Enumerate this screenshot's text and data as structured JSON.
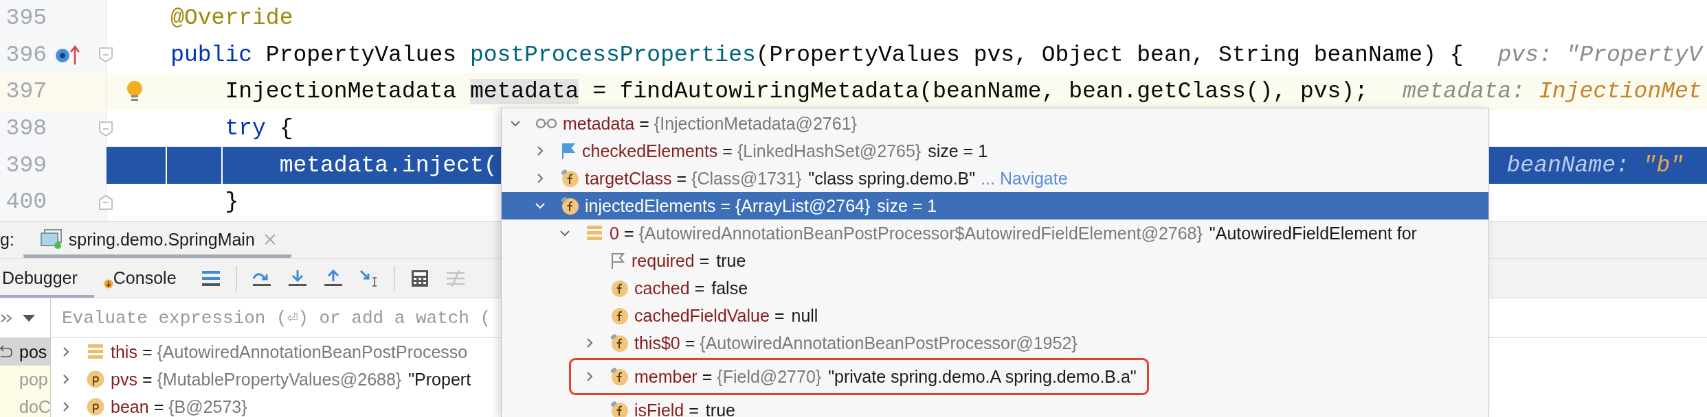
{
  "editor": {
    "lines": [
      {
        "number": "395",
        "caret_line": false,
        "execution_point": false,
        "implements_marker": false,
        "bulb": false,
        "fold_start": false,
        "fold_end": false,
        "segments": [
          {
            "text": "    @Override",
            "kind": "annotation"
          }
        ]
      },
      {
        "number": "396",
        "caret_line": false,
        "execution_point": false,
        "implements_marker": true,
        "bulb": false,
        "fold_start": true,
        "fold_end": false,
        "segments": [
          {
            "text": "    public",
            "kind": "keyword"
          },
          {
            "text": " PropertyValues ",
            "kind": "plain"
          },
          {
            "text": "postProcessProperties",
            "kind": "method"
          },
          {
            "text": "(PropertyValues pvs, Object bean, String beanName) {",
            "kind": "plain"
          }
        ],
        "hint": [
          {
            "text": "pvs: \"PropertyV",
            "kind": "muted"
          }
        ]
      },
      {
        "number": "397",
        "caret_line": true,
        "execution_point": false,
        "implements_marker": false,
        "bulb": true,
        "fold_start": false,
        "fold_end": false,
        "segments": [
          {
            "text": "        InjectionMetadata ",
            "kind": "plain"
          },
          {
            "text": "metadata",
            "kind": "marked"
          },
          {
            "text": " = findAutowiringMetadata(beanName, bean.getClass(), pvs);",
            "kind": "plain"
          }
        ],
        "hint": [
          {
            "text": "metadata: ",
            "kind": "muted"
          },
          {
            "text": "InjectionMet",
            "kind": "accent"
          }
        ]
      },
      {
        "number": "398",
        "caret_line": false,
        "execution_point": false,
        "implements_marker": false,
        "bulb": false,
        "fold_start": true,
        "fold_end": false,
        "segments": [
          {
            "text": "        try",
            "kind": "keyword"
          },
          {
            "text": " {",
            "kind": "plain"
          }
        ]
      },
      {
        "number": "399",
        "caret_line": false,
        "execution_point": true,
        "implements_marker": false,
        "bulb": false,
        "fold_start": false,
        "fold_end": false,
        "segments": [
          {
            "text": "            metadata.inject(",
            "kind": "plain"
          }
        ],
        "hint": [
          {
            "text": "beanName: ",
            "kind": "muted"
          },
          {
            "text": "\"b\"",
            "kind": "accent"
          }
        ]
      },
      {
        "number": "400",
        "caret_line": false,
        "execution_point": false,
        "implements_marker": false,
        "bulb": false,
        "fold_start": false,
        "fold_end": true,
        "segments": [
          {
            "text": "        }",
            "kind": "plain"
          }
        ]
      }
    ]
  },
  "debug_panel": {
    "cut_label": "g:",
    "session_tab": {
      "label": "spring.demo.SpringMain",
      "selected": true
    },
    "tabs": [
      {
        "label": "Debugger",
        "selected": true
      },
      {
        "label": "Console",
        "selected": false
      }
    ],
    "frames": [
      {
        "label": "pos",
        "selected": true
      },
      {
        "label": "pop",
        "selected": false
      },
      {
        "label": "doC",
        "selected": false
      }
    ],
    "evaluate": {
      "placeholder": "Evaluate expression (⏎) or add a watch ("
    },
    "variables": [
      {
        "kind": "element",
        "expanded": false,
        "parts": [
          {
            "text": "this",
            "kind": "name"
          },
          {
            "text": "=",
            "kind": "op"
          },
          {
            "text": "{AutowiredAnnotationBeanPostProcesso",
            "kind": "ref"
          }
        ]
      },
      {
        "kind": "param",
        "expanded": false,
        "parts": [
          {
            "text": "pvs",
            "kind": "name"
          },
          {
            "text": "=",
            "kind": "op"
          },
          {
            "text": "{MutablePropertyValues@2688}",
            "kind": "ref"
          },
          {
            "text": "\"Propert",
            "kind": "text"
          }
        ]
      },
      {
        "kind": "param",
        "expanded": false,
        "parts": [
          {
            "text": "bean",
            "kind": "name"
          },
          {
            "text": "=",
            "kind": "op"
          },
          {
            "text": "{B@2573}",
            "kind": "ref"
          }
        ]
      }
    ]
  },
  "popup": {
    "tree": [
      {
        "kind": "watch",
        "expanded": true,
        "selected": false,
        "outlined": false,
        "parts": [
          {
            "text": "metadata",
            "kind": "name"
          },
          {
            "text": "=",
            "kind": "op"
          },
          {
            "text": "{InjectionMetadata@2761}",
            "kind": "ref"
          }
        ],
        "children": [
          {
            "kind": "flag",
            "expanded": false,
            "selected": false,
            "outlined": false,
            "parts": [
              {
                "text": "checkedElements",
                "kind": "name"
              },
              {
                "text": "=",
                "kind": "op"
              },
              {
                "text": "{LinkedHashSet@2765}",
                "kind": "ref"
              },
              {
                "text": "size = 1",
                "kind": "text"
              }
            ]
          },
          {
            "kind": "field",
            "final": true,
            "expanded": false,
            "selected": false,
            "outlined": false,
            "parts": [
              {
                "text": "targetClass",
                "kind": "name"
              },
              {
                "text": "=",
                "kind": "op"
              },
              {
                "text": "{Class@1731}",
                "kind": "ref"
              },
              {
                "text": "\"class spring.demo.B\"",
                "kind": "text"
              },
              {
                "text": "... Navigate",
                "kind": "link"
              }
            ]
          },
          {
            "kind": "field",
            "final": true,
            "expanded": true,
            "selected": true,
            "outlined": false,
            "parts": [
              {
                "text": "injectedElements",
                "kind": "name"
              },
              {
                "text": "=",
                "kind": "op"
              },
              {
                "text": "{ArrayList@2764}",
                "kind": "ref"
              },
              {
                "text": "size = 1",
                "kind": "text"
              }
            ],
            "children": [
              {
                "kind": "element",
                "expanded": true,
                "selected": false,
                "outlined": false,
                "parts": [
                  {
                    "text": "0",
                    "kind": "name"
                  },
                  {
                    "text": "=",
                    "kind": "op"
                  },
                  {
                    "text": "{AutowiredAnnotationBeanPostProcessor$AutowiredFieldElement@2768}",
                    "kind": "ref"
                  },
                  {
                    "text": "\"AutowiredFieldElement for",
                    "kind": "text"
                  }
                ],
                "children": [
                  {
                    "kind": "flag-muted",
                    "selected": false,
                    "outlined": false,
                    "parts": [
                      {
                        "text": "required",
                        "kind": "name"
                      },
                      {
                        "text": "=",
                        "kind": "op"
                      },
                      {
                        "text": "true",
                        "kind": "text"
                      }
                    ]
                  },
                  {
                    "kind": "field",
                    "final": false,
                    "selected": false,
                    "outlined": false,
                    "parts": [
                      {
                        "text": "cached",
                        "kind": "name"
                      },
                      {
                        "text": "=",
                        "kind": "op"
                      },
                      {
                        "text": "false",
                        "kind": "text"
                      }
                    ]
                  },
                  {
                    "kind": "field",
                    "final": false,
                    "selected": false,
                    "outlined": false,
                    "parts": [
                      {
                        "text": "cachedFieldValue",
                        "kind": "name"
                      },
                      {
                        "text": "=",
                        "kind": "op"
                      },
                      {
                        "text": "null",
                        "kind": "text"
                      }
                    ]
                  },
                  {
                    "kind": "field",
                    "final": true,
                    "expanded": false,
                    "selected": false,
                    "outlined": false,
                    "parts": [
                      {
                        "text": "this$0",
                        "kind": "name"
                      },
                      {
                        "text": "=",
                        "kind": "op"
                      },
                      {
                        "text": "{AutowiredAnnotationBeanPostProcessor@1952}",
                        "kind": "ref"
                      }
                    ]
                  },
                  {
                    "kind": "field",
                    "final": true,
                    "expanded": false,
                    "selected": false,
                    "outlined": true,
                    "parts": [
                      {
                        "text": "member",
                        "kind": "name"
                      },
                      {
                        "text": "=",
                        "kind": "op"
                      },
                      {
                        "text": "{Field@2770}",
                        "kind": "ref"
                      },
                      {
                        "text": "\"private spring.demo.A spring.demo.B.a\"",
                        "kind": "text"
                      }
                    ]
                  },
                  {
                    "kind": "field",
                    "final": true,
                    "selected": false,
                    "outlined": false,
                    "parts": [
                      {
                        "text": "isField",
                        "kind": "name"
                      },
                      {
                        "text": "=",
                        "kind": "op"
                      },
                      {
                        "text": "true",
                        "kind": "text"
                      }
                    ]
                  }
                ]
              }
            ]
          }
        ]
      }
    ]
  }
}
